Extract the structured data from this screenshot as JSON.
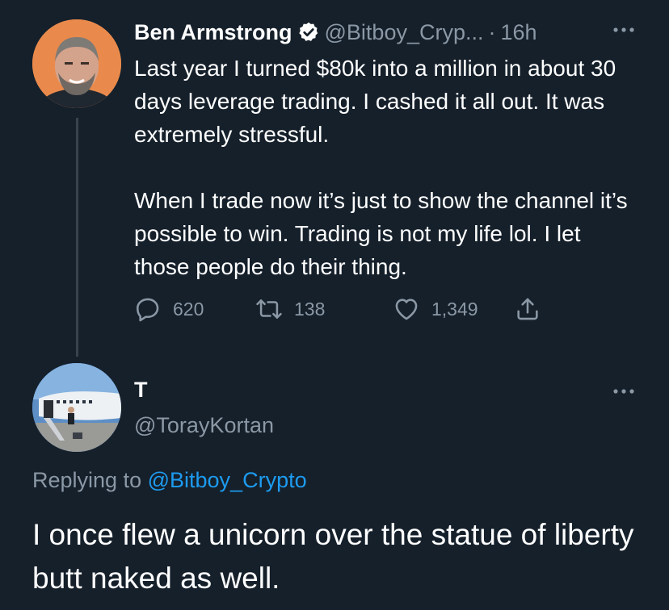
{
  "tweet": {
    "author_name": "Ben Armstrong",
    "handle": "@Bitboy_Cryp...",
    "separator": "·",
    "time": "16h",
    "paragraphs": [
      "Last year I turned $80k into a million in about 30 days leverage trading. I cashed it all out. It was extremely stressful.",
      "When I trade now it’s just to show the channel it’s possible to win. Trading is not my life lol. I let those people do their thing."
    ],
    "actions": {
      "replies": "620",
      "retweets": "138",
      "likes": "1,349"
    }
  },
  "reply": {
    "author_name": "T",
    "handle": "@TorayKortan",
    "replying_prefix": "Replying to",
    "replying_to": "@Bitboy_Crypto",
    "text": "I once flew a unicorn over the statue of liberty butt naked as well."
  },
  "colors": {
    "background": "#15202b",
    "text": "#ffffff",
    "muted": "#8b98a5",
    "link": "#1d9bf0",
    "verified": "#1d9bf0"
  },
  "icons": [
    "verified-badge-icon",
    "more-icon",
    "reply-icon",
    "retweet-icon",
    "like-icon",
    "share-icon"
  ]
}
